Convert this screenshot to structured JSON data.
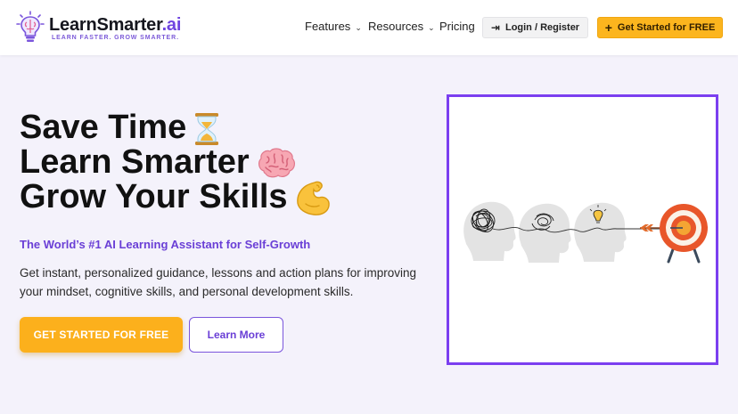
{
  "brand": {
    "name_main": "LearnSmarter",
    "name_suffix": ".ai",
    "tagline": "LEARN FASTER. GROW SMARTER.",
    "accent_color": "#6f45e0",
    "cta_color": "#fcb51e"
  },
  "nav": {
    "items": [
      {
        "label": "Features",
        "has_dropdown": true
      },
      {
        "label": "Resources",
        "has_dropdown": true
      },
      {
        "label": "Pricing",
        "has_dropdown": false
      }
    ],
    "login_label": "Login / Register",
    "login_icon": "login-arrow-icon",
    "cta_label": "Get Started for FREE",
    "cta_icon": "plus-icon"
  },
  "hero": {
    "headline": [
      {
        "text": "Save Time",
        "emoji": "hourglass-icon"
      },
      {
        "text": "Learn Smarter",
        "emoji": "brain-icon"
      },
      {
        "text": "Grow Your Skills",
        "emoji": "flexed-biceps-icon"
      }
    ],
    "subheadline": "The World’s #1 AI Learning Assistant for Self-Growth",
    "description": "Get instant, personalized guidance, lessons and action plans for improving your mindset, cognitive skills, and personal development skills.",
    "primary_button": "GET STARTED FOR FREE",
    "secondary_button": "Learn More"
  },
  "illustration": {
    "description_icons": [
      "tangled-thoughts-head-icon",
      "untangling-head-icon",
      "lightbulb-head-icon",
      "arrow-icon",
      "target-icon"
    ],
    "frame_color": "#7b3ff0"
  }
}
